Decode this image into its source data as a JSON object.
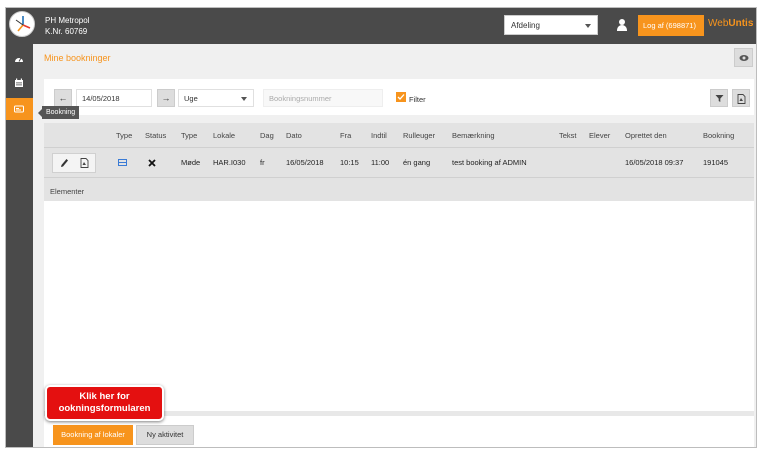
{
  "header": {
    "school_name": "PH Metropol",
    "school_number": "K.Nr. 60769",
    "department": "Afdeling",
    "logout_label": "Log af (698871)",
    "brand_web": "Web",
    "brand_untis": "Untis"
  },
  "sidebar": {
    "items": [
      {
        "icon": "dashboard-icon"
      },
      {
        "icon": "calendar-icon"
      },
      {
        "icon": "booking-icon",
        "active": true
      }
    ],
    "tooltip": "Bookning"
  },
  "page": {
    "title": "Mine bookninger"
  },
  "filter": {
    "date": "14/05/2018",
    "period": "Uge",
    "booking_placeholder": "Bookningsnummer",
    "filter_label": "Filter"
  },
  "table": {
    "headers": [
      "Type",
      "Status",
      "Type",
      "Lokale",
      "Dag",
      "Dato",
      "Fra",
      "Indtil",
      "Rulleuger",
      "Bemærkning",
      "Tekst",
      "Elever",
      "Oprettet den",
      "Bookning"
    ],
    "rows": [
      {
        "type2": "Møde",
        "room": "HAR.I030",
        "day": "fr",
        "date": "16/05/2018",
        "from": "10:15",
        "until": "11:00",
        "repeat": "én gang",
        "note": "test booking af ADMIN",
        "text": "",
        "students": "",
        "created": "16/05/2018 09:37",
        "booking": "191045"
      }
    ],
    "elements_label": "Elementer"
  },
  "footer": {
    "primary_label": "Bookning af lokaler",
    "secondary_label": "Ny aktivitet"
  },
  "callout": {
    "line1": "Klik her for",
    "line2": "ookningsformularen"
  },
  "colors": {
    "accent": "#f7941d",
    "dark": "#4a4a4a",
    "callout": "#e41010"
  }
}
